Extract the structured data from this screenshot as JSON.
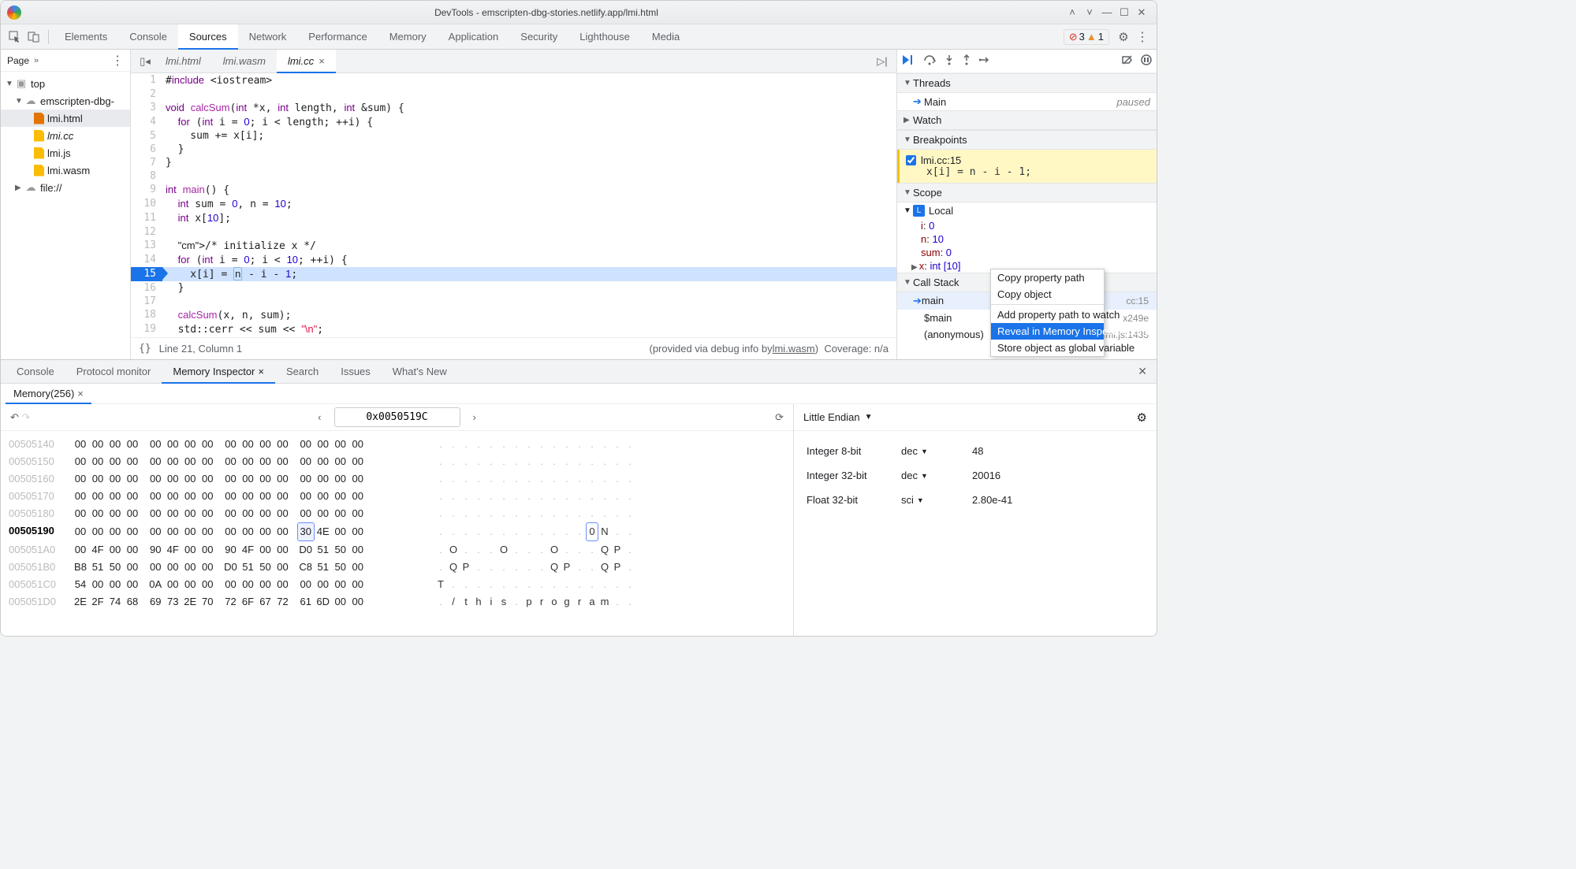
{
  "title": "DevTools - emscripten-dbg-stories.netlify.app/lmi.html",
  "errors": "3",
  "warnings": "1",
  "mainTabs": [
    "Elements",
    "Console",
    "Sources",
    "Network",
    "Performance",
    "Memory",
    "Application",
    "Security",
    "Lighthouse",
    "Media"
  ],
  "activeMainTab": "Sources",
  "sidebar": {
    "title": "Page",
    "tree": {
      "top": "top",
      "origin": "emscripten-dbg-",
      "files": [
        "lmi.html",
        "lmi.cc",
        "lmi.js",
        "lmi.wasm"
      ],
      "file2": "file://"
    }
  },
  "editorTabs": [
    {
      "label": "lmi.html"
    },
    {
      "label": "lmi.wasm"
    },
    {
      "label": "lmi.cc",
      "active": true
    }
  ],
  "code": [
    "#include <iostream>",
    "",
    "void calcSum(int *x, int length, int &sum) {",
    "  for (int i = 0; i < length; ++i) {",
    "    sum += x[i];",
    "  }",
    "}",
    "",
    "int main() {",
    "  int sum = 0, n = 10;",
    "  int x[10];",
    "",
    "  /* initialize x */",
    "  for (int i = 0; i < 10; ++i) {",
    "    x[i] = n - i - 1;",
    "  }",
    "",
    "  calcSum(x, n, sum);",
    "  std::cerr << sum << \"\\n\";",
    "}",
    ""
  ],
  "execLine": 15,
  "status": {
    "pos": "Line 21, Column 1",
    "provided": "(provided via debug info by ",
    "wasm": "lmi.wasm",
    "coverage": "Coverage: n/a"
  },
  "debug": {
    "threads": "Threads",
    "main": "Main",
    "paused": "paused",
    "watch": "Watch",
    "breakpoints": "Breakpoints",
    "bp": {
      "file": "lmi.cc:15",
      "code": "x[i] = n - i - 1;"
    },
    "scope": "Scope",
    "local": "Local",
    "vars": [
      {
        "n": "i",
        "v": "0"
      },
      {
        "n": "n",
        "v": "10"
      },
      {
        "n": "sum",
        "v": "0"
      },
      {
        "n": "x",
        "v": "int [10]",
        "expandable": true
      }
    ],
    "callstack": "Call Stack",
    "frames": [
      {
        "name": "main",
        "loc": "cc:15",
        "sel": true
      },
      {
        "name": "$main",
        "loc": "x249e"
      },
      {
        "name": "(anonymous)",
        "loc": "lmi.js:1435"
      }
    ]
  },
  "contextMenu": [
    "Copy property path",
    "Copy object",
    "Add property path to watch",
    "Reveal in Memory Inspector panel",
    "Store object as global variable"
  ],
  "contextMenuSel": 3,
  "drawer": {
    "tabs": [
      "Console",
      "Protocol monitor",
      "Memory Inspector",
      "Search",
      "Issues",
      "What's New"
    ],
    "active": "Memory Inspector",
    "memTab": "Memory(256)",
    "address": "0x0050519C",
    "endian": "Little Endian",
    "hex": [
      {
        "a": "00505140",
        "b": [
          "00",
          "00",
          "00",
          "00",
          "00",
          "00",
          "00",
          "00",
          "00",
          "00",
          "00",
          "00",
          "00",
          "00",
          "00",
          "00"
        ],
        "t": ". . . . . . . . . . . . . . . ."
      },
      {
        "a": "00505150",
        "b": [
          "00",
          "00",
          "00",
          "00",
          "00",
          "00",
          "00",
          "00",
          "00",
          "00",
          "00",
          "00",
          "00",
          "00",
          "00",
          "00"
        ],
        "t": ". . . . . . . . . . . . . . . ."
      },
      {
        "a": "00505160",
        "b": [
          "00",
          "00",
          "00",
          "00",
          "00",
          "00",
          "00",
          "00",
          "00",
          "00",
          "00",
          "00",
          "00",
          "00",
          "00",
          "00"
        ],
        "t": ". . . . . . . . . . . . . . . ."
      },
      {
        "a": "00505170",
        "b": [
          "00",
          "00",
          "00",
          "00",
          "00",
          "00",
          "00",
          "00",
          "00",
          "00",
          "00",
          "00",
          "00",
          "00",
          "00",
          "00"
        ],
        "t": ". . . . . . . . . . . . . . . ."
      },
      {
        "a": "00505180",
        "b": [
          "00",
          "00",
          "00",
          "00",
          "00",
          "00",
          "00",
          "00",
          "00",
          "00",
          "00",
          "00",
          "00",
          "00",
          "00",
          "00"
        ],
        "t": ". . . . . . . . . . . . . . . ."
      },
      {
        "a": "00505190",
        "b": [
          "00",
          "00",
          "00",
          "00",
          "00",
          "00",
          "00",
          "00",
          "00",
          "00",
          "00",
          "00",
          "30",
          "4E",
          "00",
          "00"
        ],
        "t": ". . . . . . . . . . . . 0 N . .",
        "bold": true,
        "hlByte": 12,
        "hlAsc": 12
      },
      {
        "a": "005051A0",
        "b": [
          "00",
          "4F",
          "00",
          "00",
          "90",
          "4F",
          "00",
          "00",
          "90",
          "4F",
          "00",
          "00",
          "D0",
          "51",
          "50",
          "00"
        ],
        "t": ". O . . . O . . . O . . . Q P ."
      },
      {
        "a": "005051B0",
        "b": [
          "B8",
          "51",
          "50",
          "00",
          "00",
          "00",
          "00",
          "00",
          "D0",
          "51",
          "50",
          "00",
          "C8",
          "51",
          "50",
          "00"
        ],
        "t": ". Q P . . . . . . Q P . . Q P ."
      },
      {
        "a": "005051C0",
        "b": [
          "54",
          "00",
          "00",
          "00",
          "0A",
          "00",
          "00",
          "00",
          "00",
          "00",
          "00",
          "00",
          "00",
          "00",
          "00",
          "00"
        ],
        "t": "T . . . . . . . . . . . . . . ."
      },
      {
        "a": "005051D0",
        "b": [
          "2E",
          "2F",
          "74",
          "68",
          "69",
          "73",
          "2E",
          "70",
          "72",
          "6F",
          "67",
          "72",
          "61",
          "6D",
          "00",
          "00"
        ],
        "t": ". / t h i s . p r o g r a m . ."
      }
    ],
    "values": [
      {
        "label": "Integer 8-bit",
        "fmt": "dec",
        "val": "48"
      },
      {
        "label": "Integer 32-bit",
        "fmt": "dec",
        "val": "20016"
      },
      {
        "label": "Float 32-bit",
        "fmt": "sci",
        "val": "2.80e-41"
      }
    ]
  }
}
